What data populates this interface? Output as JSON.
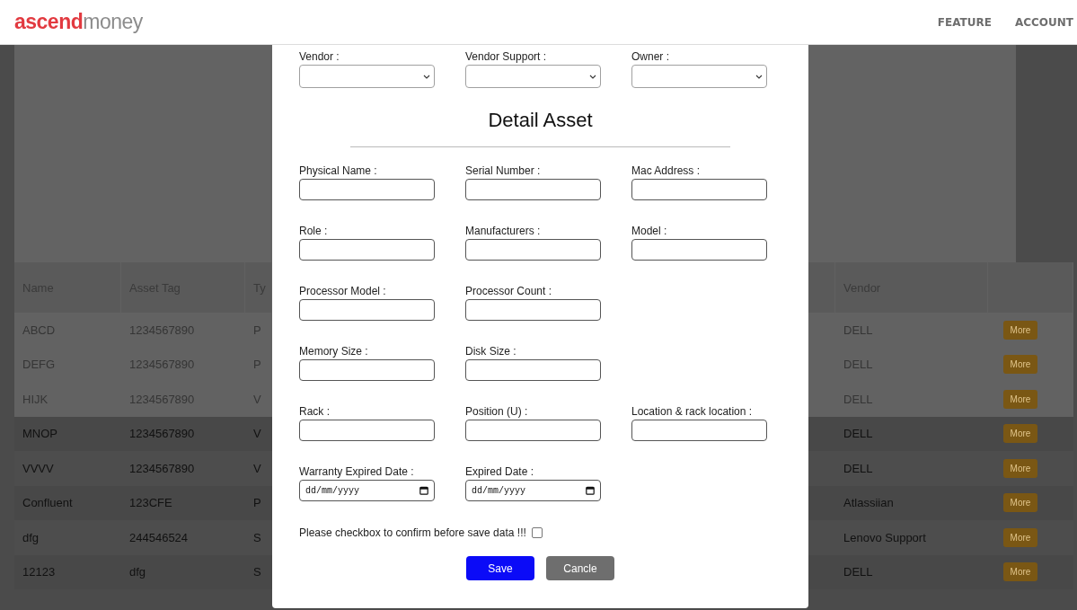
{
  "header": {
    "logo": {
      "brand": "ascend",
      "suffix": "money"
    },
    "nav": [
      {
        "label": "FEATURE"
      },
      {
        "label": "ACCOUNT"
      }
    ]
  },
  "table": {
    "columns": [
      {
        "label": "Name"
      },
      {
        "label": "Asset Tag"
      },
      {
        "label": "Ty"
      },
      {
        "label": "Vendor"
      }
    ],
    "rows": [
      {
        "name": "ABCD",
        "asset_tag": "1234567890",
        "type": "P",
        "vendor": "DELL",
        "action": "More"
      },
      {
        "name": "DEFG",
        "asset_tag": "1234567890",
        "type": "P",
        "vendor": "DELL",
        "action": "More"
      },
      {
        "name": "HIJK",
        "asset_tag": "1234567890",
        "type": "V",
        "vendor": "DELL",
        "action": "More"
      },
      {
        "name": "MNOP",
        "asset_tag": "1234567890",
        "type": "V",
        "vendor": "DELL",
        "action": "More"
      },
      {
        "name": "VVVV",
        "asset_tag": "1234567890",
        "type": "V",
        "vendor": "DELL",
        "action": "More"
      },
      {
        "name": "Confluent",
        "asset_tag": "123CFE",
        "type": "P",
        "vendor": "Atlassiian",
        "action": "More"
      },
      {
        "name": "dfg",
        "asset_tag": "244546524",
        "type": "S",
        "vendor": "Lenovo Support",
        "action": "More"
      },
      {
        "name": "12123",
        "asset_tag": "dfg",
        "type": "S",
        "vendor": "DELL",
        "action": "More"
      }
    ]
  },
  "modal": {
    "selects": [
      {
        "label": "Vendor :"
      },
      {
        "label": "Vendor Support :"
      },
      {
        "label": "Owner :"
      }
    ],
    "title": "Detail Asset",
    "field_rows": [
      [
        {
          "label": "Physical Name :",
          "kind": "text"
        },
        {
          "label": "Serial Number :",
          "kind": "text"
        },
        {
          "label": "Mac Address :",
          "kind": "text"
        }
      ],
      [
        {
          "label": "Role :",
          "kind": "text"
        },
        {
          "label": "Manufacturers :",
          "kind": "text"
        },
        {
          "label": "Model :",
          "kind": "text"
        }
      ],
      [
        {
          "label": "Processor Model :",
          "kind": "text"
        },
        {
          "label": "Processor Count :",
          "kind": "text"
        }
      ],
      [
        {
          "label": "Memory Size :",
          "kind": "text"
        },
        {
          "label": "Disk Size :",
          "kind": "text"
        }
      ],
      [
        {
          "label": "Rack :",
          "kind": "text"
        },
        {
          "label": "Position (U) :",
          "kind": "text"
        },
        {
          "label": "Location & rack location :",
          "kind": "text"
        }
      ],
      [
        {
          "label": "Warranty Expired Date :",
          "kind": "date",
          "placeholder": "dd/mm/yyyy"
        },
        {
          "label": "Expired Date :",
          "kind": "date",
          "placeholder": "dd/mm/yyyy"
        }
      ]
    ],
    "confirm": {
      "label": "Please checkbox to confirm before save data !!!",
      "checked": false
    },
    "buttons": [
      {
        "label": "Save",
        "kind": "primary"
      },
      {
        "label": "Cancle",
        "kind": "secondary"
      }
    ]
  }
}
